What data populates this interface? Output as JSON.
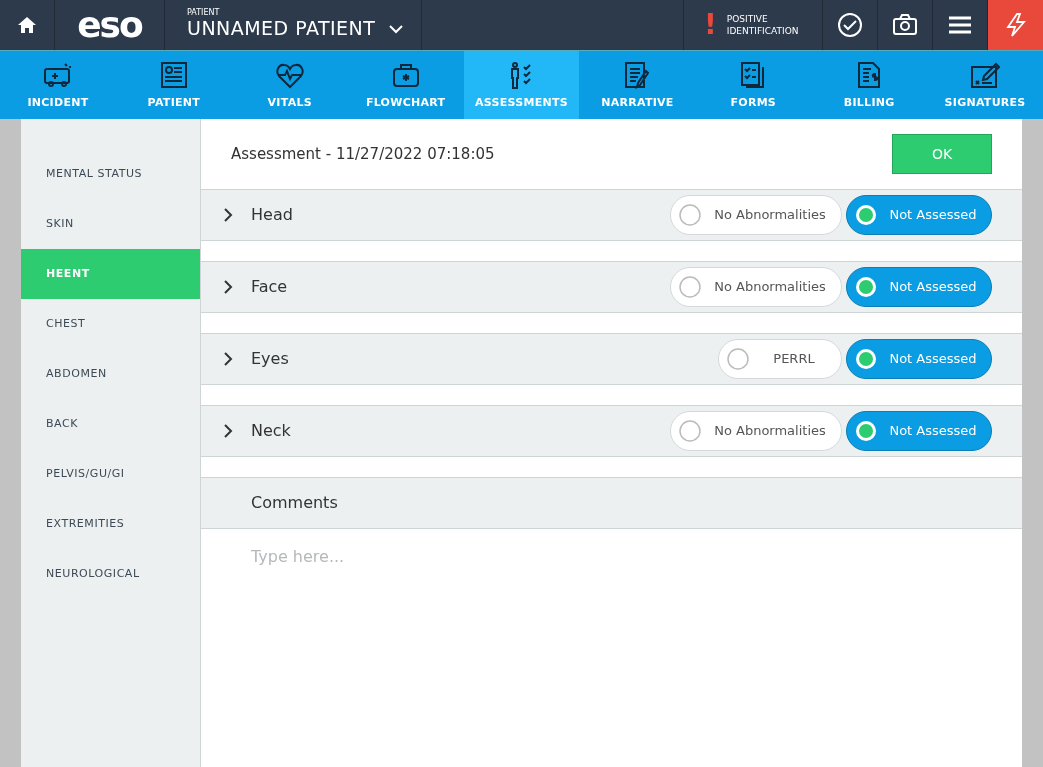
{
  "top_bar": {
    "logo": "eso",
    "patient_label": "PATIENT",
    "patient_name": "UNNAMED PATIENT",
    "alert_mark": "!",
    "alert_text": "POSITIVE IDENTIFICATION"
  },
  "nav_tabs": [
    {
      "label": "INCIDENT",
      "selected": false
    },
    {
      "label": "PATIENT",
      "selected": false
    },
    {
      "label": "VITALS",
      "selected": false
    },
    {
      "label": "FLOWCHART",
      "selected": false
    },
    {
      "label": "ASSESSMENTS",
      "selected": true
    },
    {
      "label": "NARRATIVE",
      "selected": false
    },
    {
      "label": "FORMS",
      "selected": false
    },
    {
      "label": "BILLING",
      "selected": false
    },
    {
      "label": "SIGNATURES",
      "selected": false
    }
  ],
  "sidebar": {
    "items": [
      {
        "label": "MENTAL STATUS",
        "selected": false
      },
      {
        "label": "SKIN",
        "selected": false
      },
      {
        "label": "HEENT",
        "selected": true
      },
      {
        "label": "CHEST",
        "selected": false
      },
      {
        "label": "ABDOMEN",
        "selected": false
      },
      {
        "label": "BACK",
        "selected": false
      },
      {
        "label": "PELVIS/GU/GI",
        "selected": false
      },
      {
        "label": "EXTREMITIES",
        "selected": false
      },
      {
        "label": "NEUROLOGICAL",
        "selected": false
      }
    ]
  },
  "assessment": {
    "title": "Assessment - 11/27/2022 07:18:05",
    "ok_button": "OK",
    "sections": [
      {
        "label": "Head",
        "expanded": false,
        "options": [
          {
            "label": "No Abnormalities",
            "selected": false
          },
          {
            "label": "Not Assessed",
            "selected": true
          }
        ]
      },
      {
        "label": "Face",
        "expanded": false,
        "options": [
          {
            "label": "No Abnormalities",
            "selected": false
          },
          {
            "label": "Not Assessed",
            "selected": true
          }
        ]
      },
      {
        "label": "Eyes",
        "expanded": false,
        "options": [
          {
            "label": "PERRL",
            "selected": false
          },
          {
            "label": "Not Assessed",
            "selected": true
          }
        ]
      },
      {
        "label": "Neck",
        "expanded": false,
        "options": [
          {
            "label": "No Abnormalities",
            "selected": false
          },
          {
            "label": "Not Assessed",
            "selected": true
          }
        ]
      }
    ],
    "comments": {
      "label": "Comments",
      "placeholder": "Type here..."
    }
  }
}
